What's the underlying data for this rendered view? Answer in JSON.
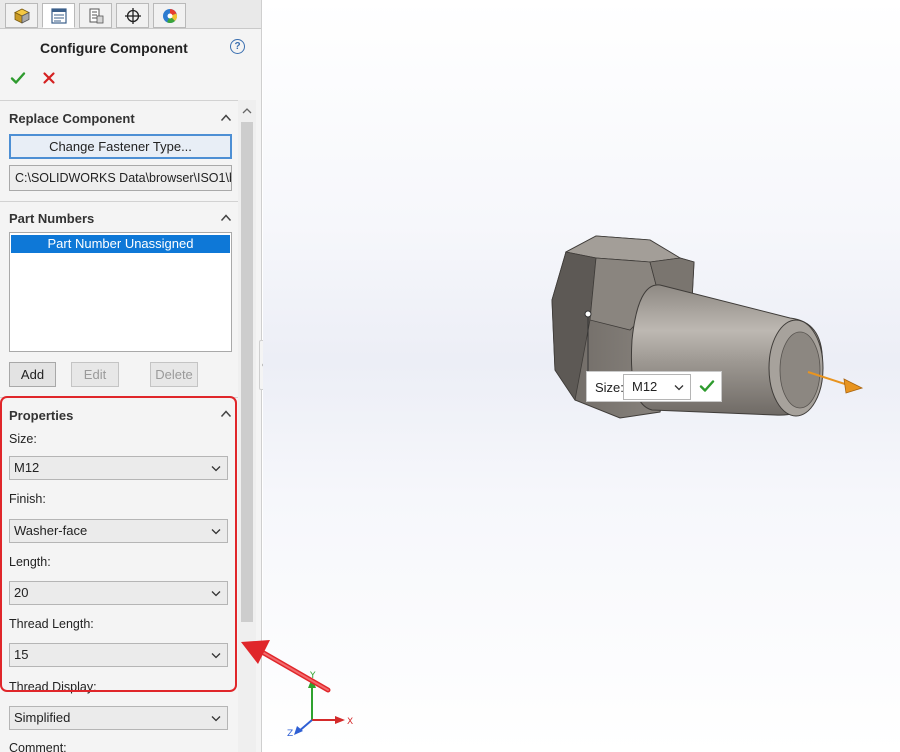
{
  "tabs": [
    {
      "icon": "feature-manager-icon"
    },
    {
      "icon": "property-manager-icon"
    },
    {
      "icon": "configuration-manager-icon"
    },
    {
      "icon": "dimxpert-icon"
    },
    {
      "icon": "display-manager-icon"
    }
  ],
  "property_manager": {
    "title": "Configure Component",
    "ok_icon": "checkmark-icon",
    "cancel_icon": "x-icon",
    "help_icon": "?"
  },
  "replace_component": {
    "title": "Replace Component",
    "change_button": "Change Fastener Type...",
    "path_value": "C:\\SOLIDWORKS Data\\browser\\ISO1\\b"
  },
  "part_numbers": {
    "title": "Part Numbers",
    "items": [
      "Part Number Unassigned"
    ],
    "add_button": "Add",
    "edit_button": "Edit",
    "delete_button": "Delete"
  },
  "properties": {
    "title": "Properties",
    "size_label": "Size:",
    "size_value": "M12",
    "finish_label": "Finish:",
    "finish_value": "Washer-face",
    "length_label": "Length:",
    "length_value": "20",
    "thread_length_label": "Thread Length:",
    "thread_length_value": "15",
    "thread_display_label": "Thread Display:",
    "thread_display_value": "Simplified",
    "comment_label": "Comment:"
  },
  "viewport": {
    "size_popup_label": "Size:",
    "size_popup_value": "M12",
    "triad": {
      "x": "X",
      "y": "Y",
      "z": "Z"
    }
  },
  "colors": {
    "accent_blue": "#0e78d7",
    "highlight_red": "#e0262a",
    "ok_green": "#2e9b2e",
    "cancel_red": "#d42020",
    "bolt_gray": "#8f8a84",
    "direction_arrow": "#e8941f"
  }
}
